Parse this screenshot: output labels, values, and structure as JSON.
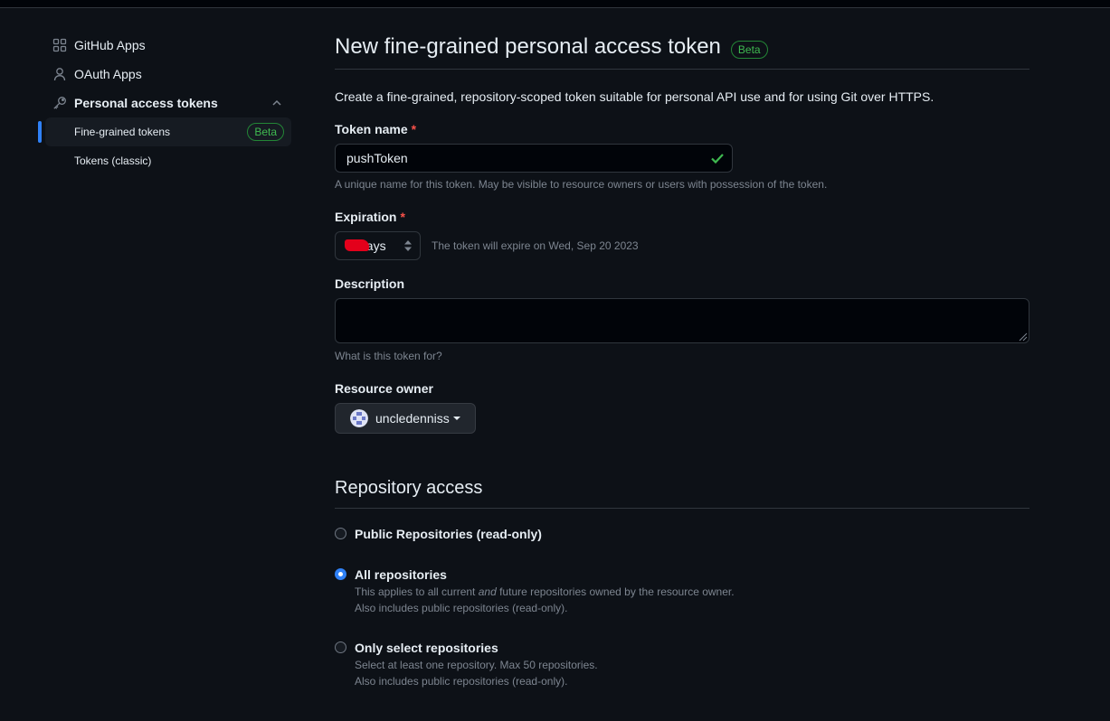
{
  "sidebar": {
    "items": [
      {
        "label": "GitHub Apps",
        "icon": "apps-icon"
      },
      {
        "label": "OAuth Apps",
        "icon": "person-icon"
      },
      {
        "label": "Personal access tokens",
        "icon": "key-icon"
      }
    ],
    "subitems": [
      {
        "label": "Fine-grained tokens",
        "badge": "Beta",
        "active": true
      },
      {
        "label": "Tokens (classic)"
      }
    ]
  },
  "header": {
    "title": "New fine-grained personal access token",
    "badge": "Beta"
  },
  "intro": "Create a fine-grained, repository-scoped token suitable for personal API use and for using Git over HTTPS.",
  "token_name": {
    "label": "Token name",
    "required": "*",
    "value": "pushToken",
    "note": "A unique name for this token. May be visible to resource owners or users with possession of the token."
  },
  "expiration": {
    "label": "Expiration",
    "required": "*",
    "value": "days",
    "note": "The token will expire on Wed, Sep 20 2023"
  },
  "description": {
    "label": "Description",
    "value": "",
    "note": "What is this token for?"
  },
  "resource_owner": {
    "label": "Resource owner",
    "value": "uncledenniss"
  },
  "repository_access": {
    "title": "Repository access",
    "options": [
      {
        "label": "Public Repositories (read-only)",
        "checked": false
      },
      {
        "label": "All repositories",
        "checked": true,
        "note_a": "This applies to all current ",
        "note_em": "and",
        "note_b": " future repositories owned by the resource owner.",
        "note2": "Also includes public repositories (read-only)."
      },
      {
        "label": "Only select repositories",
        "checked": false,
        "note1": "Select at least one repository. Max 50 repositories.",
        "note2": "Also includes public repositories (read-only)."
      }
    ]
  },
  "colors": {
    "background": "#0d1117",
    "accent": "#2f81f7",
    "success": "#3fb950",
    "danger": "#f85149",
    "redaction": "#e3001b"
  }
}
